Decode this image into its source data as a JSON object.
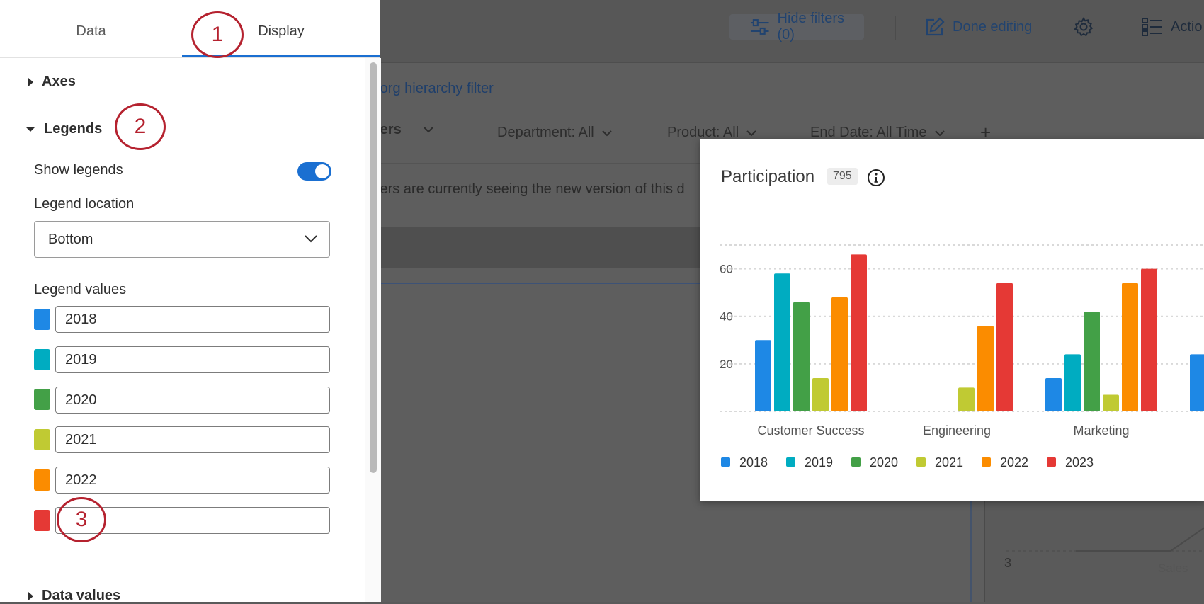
{
  "topbar": {
    "hide_filters_label": "Hide filters (0)",
    "done_editing_label": "Done editing",
    "actions_label": "Actio"
  },
  "dashboard": {
    "org_filter_link": "n org hierarchy filter",
    "filters_label": "ters",
    "filters": [
      {
        "label": "Department: All"
      },
      {
        "label": "Product: All"
      },
      {
        "label": "End Date: All Time"
      }
    ],
    "add_filter_symbol": "+",
    "notice_text": "wers are currently seeing the new version of this d",
    "bg_tick_label": "3",
    "bg_category_label": "Sales"
  },
  "panel": {
    "tabs": [
      {
        "label": "Data"
      },
      {
        "label": "Display"
      }
    ],
    "sections": {
      "axes": "Axes",
      "legends": "Legends",
      "data_values": "Data values"
    },
    "show_legends_label": "Show legends",
    "show_legends_on": true,
    "legend_location_label": "Legend location",
    "legend_location_value": "Bottom",
    "legend_values_label": "Legend values",
    "legend_values": [
      {
        "value": "2018",
        "color": "#1e88e5"
      },
      {
        "value": "2019",
        "color": "#00acc1"
      },
      {
        "value": "2020",
        "color": "#43a047"
      },
      {
        "value": "2021",
        "color": "#c0ca33"
      },
      {
        "value": "2022",
        "color": "#fb8c00"
      },
      {
        "value": "",
        "color": "#e53935"
      }
    ]
  },
  "callouts": [
    "1",
    "2",
    "3"
  ],
  "card": {
    "title": "Participation",
    "count": "795"
  },
  "chart_data": {
    "type": "bar",
    "title": "Participation",
    "categories": [
      "Customer Success",
      "Engineering",
      "Marketing"
    ],
    "series": [
      {
        "name": "2018",
        "color": "#1e88e5",
        "values": [
          30,
          0,
          14
        ]
      },
      {
        "name": "2019",
        "color": "#00acc1",
        "values": [
          58,
          0,
          24
        ]
      },
      {
        "name": "2020",
        "color": "#43a047",
        "values": [
          46,
          0,
          42
        ]
      },
      {
        "name": "2021",
        "color": "#c0ca33",
        "values": [
          14,
          10,
          7
        ]
      },
      {
        "name": "2022",
        "color": "#fb8c00",
        "values": [
          48,
          36,
          54
        ]
      },
      {
        "name": "2023",
        "color": "#e53935",
        "values": [
          66,
          54,
          60
        ]
      }
    ],
    "partial_next_category_first_value": 24,
    "yticks": [
      20,
      40,
      60
    ],
    "ylim": [
      0,
      70
    ],
    "grid": true,
    "legend_position": "bottom"
  }
}
